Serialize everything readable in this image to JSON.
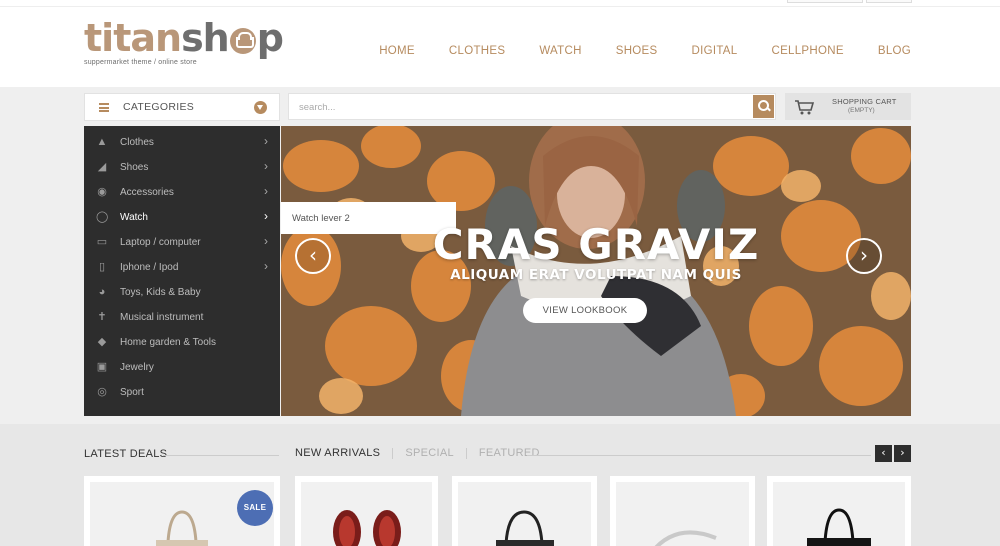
{
  "brand": {
    "logo_part1": "titan",
    "logo_part2": "sh",
    "logo_part3": "p",
    "tagline": "suppermarket theme / online store",
    "accent_color": "#b68b5f",
    "dark_color": "#2d2d2d"
  },
  "nav": {
    "items": [
      {
        "label": "HOME"
      },
      {
        "label": "CLOTHES"
      },
      {
        "label": "WATCH"
      },
      {
        "label": "SHOES"
      },
      {
        "label": "DIGITAL"
      },
      {
        "label": "CELLPHONE"
      },
      {
        "label": "BLOG"
      }
    ]
  },
  "categories": {
    "title": "CATEGORIES",
    "items": [
      {
        "label": "Clothes",
        "icon": "dress-icon",
        "has_submenu": true
      },
      {
        "label": "Shoes",
        "icon": "shoe-icon",
        "has_submenu": true
      },
      {
        "label": "Accessories",
        "icon": "ball-icon",
        "has_submenu": true
      },
      {
        "label": "Watch",
        "icon": "watch-icon",
        "has_submenu": true
      },
      {
        "label": "Laptop / computer",
        "icon": "laptop-icon",
        "has_submenu": true
      },
      {
        "label": "Iphone / Ipod",
        "icon": "phone-icon",
        "has_submenu": true
      },
      {
        "label": "Toys, Kids & Baby",
        "icon": "cap-icon",
        "has_submenu": false
      },
      {
        "label": "Musical instrument",
        "icon": "wrench-icon",
        "has_submenu": false
      },
      {
        "label": "Home garden & Tools",
        "icon": "diamond-icon",
        "has_submenu": false
      },
      {
        "label": "Jewelry",
        "icon": "gift-icon",
        "has_submenu": false
      },
      {
        "label": "Sport",
        "icon": "globe-icon",
        "has_submenu": false
      }
    ]
  },
  "search": {
    "placeholder": "search..."
  },
  "cart": {
    "title": "SHOPPING CART",
    "status": "(EMPTY)"
  },
  "slider": {
    "caption": "Watch lever 2",
    "headline": "CRAS GRAVIZ",
    "subline": "ALIQUAM ERAT VOLUTPAT NAM QUIS",
    "button": "VIEW LOOKBOOK",
    "prev_icon": "chevron-left-icon",
    "next_icon": "chevron-right-icon"
  },
  "deals": {
    "title": "LATEST DEALS",
    "sale_badge": "SALE"
  },
  "product_tabs": {
    "items": [
      {
        "label": "NEW ARRIVALS",
        "active": true
      },
      {
        "label": "SPECIAL",
        "active": false
      },
      {
        "label": "FEATURED",
        "active": false
      }
    ]
  },
  "products": [
    {
      "image": "handbag-beige"
    },
    {
      "image": "red-heels"
    },
    {
      "image": "black-handbag"
    },
    {
      "image": "white-handbag"
    },
    {
      "image": "black-tote"
    }
  ]
}
